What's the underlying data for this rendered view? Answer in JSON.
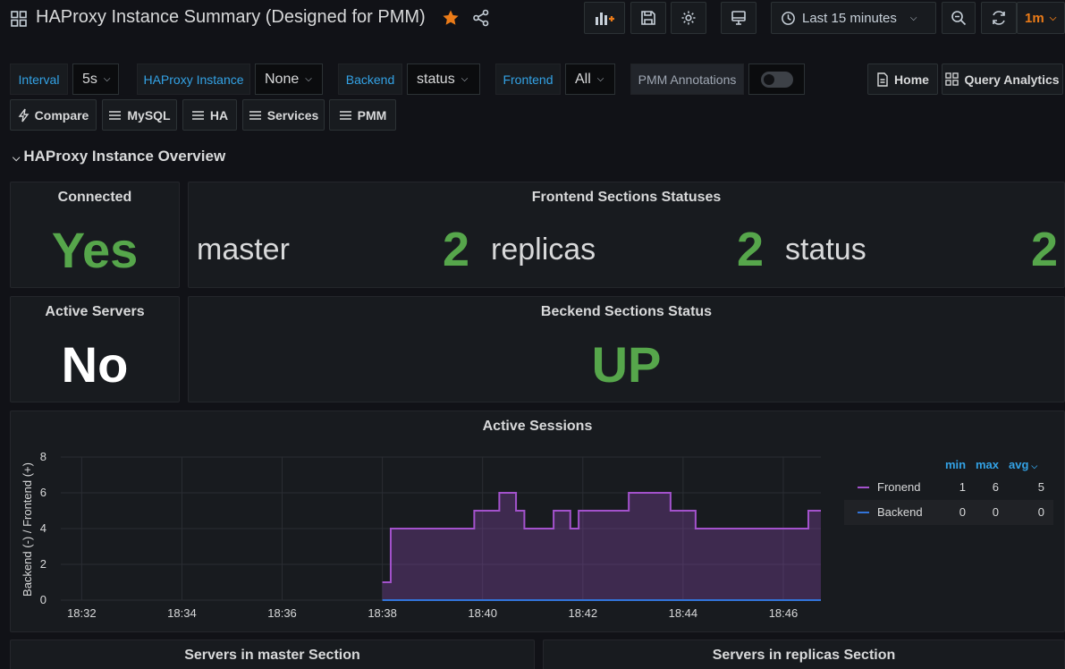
{
  "header": {
    "title": "HAProxy Instance Summary (Designed for PMM)",
    "time_range": "Last 15 minutes",
    "refresh": "1m"
  },
  "variables": {
    "interval": {
      "label": "Interval",
      "value": "5s"
    },
    "instance": {
      "label": "HAProxy Instance",
      "value": "None"
    },
    "backend": {
      "label": "Backend",
      "value": "status"
    },
    "frontend": {
      "label": "Frontend",
      "value": "All"
    },
    "annotations": {
      "label": "PMM Annotations",
      "enabled": false
    }
  },
  "links": {
    "home": "Home",
    "query_analytics": "Query Analytics",
    "compare": "Compare",
    "mysql": "MySQL",
    "ha": "HA",
    "services": "Services",
    "pmm": "PMM"
  },
  "row_title": "HAProxy Instance Overview",
  "panels": {
    "connected": {
      "title": "Connected",
      "value": "Yes"
    },
    "frontend_statuses": {
      "title": "Frontend Sections Statuses",
      "items": [
        {
          "name": "master",
          "value": "2"
        },
        {
          "name": "replicas",
          "value": "2"
        },
        {
          "name": "status",
          "value": "2"
        }
      ]
    },
    "active_servers": {
      "title": "Active Servers",
      "value": "No"
    },
    "backend_status": {
      "title": "Beckend Sections Status",
      "value": "UP"
    },
    "active_sessions": {
      "title": "Active Sessions"
    },
    "servers_master": {
      "title": "Servers in master Section"
    },
    "servers_replicas": {
      "title": "Servers in replicas Section"
    }
  },
  "legend": {
    "headers": {
      "min": "min",
      "max": "max",
      "avg": "avg"
    },
    "rows": [
      {
        "name": "Fronend",
        "min": "1",
        "max": "6",
        "avg": "5"
      },
      {
        "name": "Backend",
        "min": "0",
        "max": "0",
        "avg": "0"
      }
    ]
  },
  "colors": {
    "green": "#56a64b",
    "purple": "#a352cc",
    "blue": "#3274d9",
    "link_blue": "#33a2e5",
    "star": "#eb7b18"
  },
  "chart_data": {
    "type": "line",
    "ylabel": "Backend (-) / Frontend (+)",
    "ylim": [
      0,
      8
    ],
    "yticks": [
      "0",
      "2",
      "4",
      "6",
      "8"
    ],
    "xticks": [
      "18:32",
      "18:34",
      "18:36",
      "18:38",
      "18:40",
      "18:42",
      "18:44",
      "18:46"
    ],
    "xlim": [
      "18:31:35",
      "18:46:45"
    ],
    "series": [
      {
        "name": "Fronend",
        "color": "#a352cc",
        "fill": true,
        "step": true,
        "points": [
          [
            "18:38:00",
            1
          ],
          [
            "18:38:10",
            4
          ],
          [
            "18:39:50",
            5
          ],
          [
            "18:40:20",
            6
          ],
          [
            "18:40:40",
            5
          ],
          [
            "18:40:50",
            4
          ],
          [
            "18:41:25",
            5
          ],
          [
            "18:41:45",
            4
          ],
          [
            "18:41:55",
            5
          ],
          [
            "18:42:55",
            6
          ],
          [
            "18:43:45",
            5
          ],
          [
            "18:44:15",
            4
          ],
          [
            "18:46:30",
            5
          ],
          [
            "18:46:45",
            5
          ]
        ]
      },
      {
        "name": "Backend",
        "color": "#3274d9",
        "fill": false,
        "step": true,
        "points": [
          [
            "18:38:00",
            0
          ],
          [
            "18:46:45",
            0
          ]
        ]
      }
    ]
  }
}
